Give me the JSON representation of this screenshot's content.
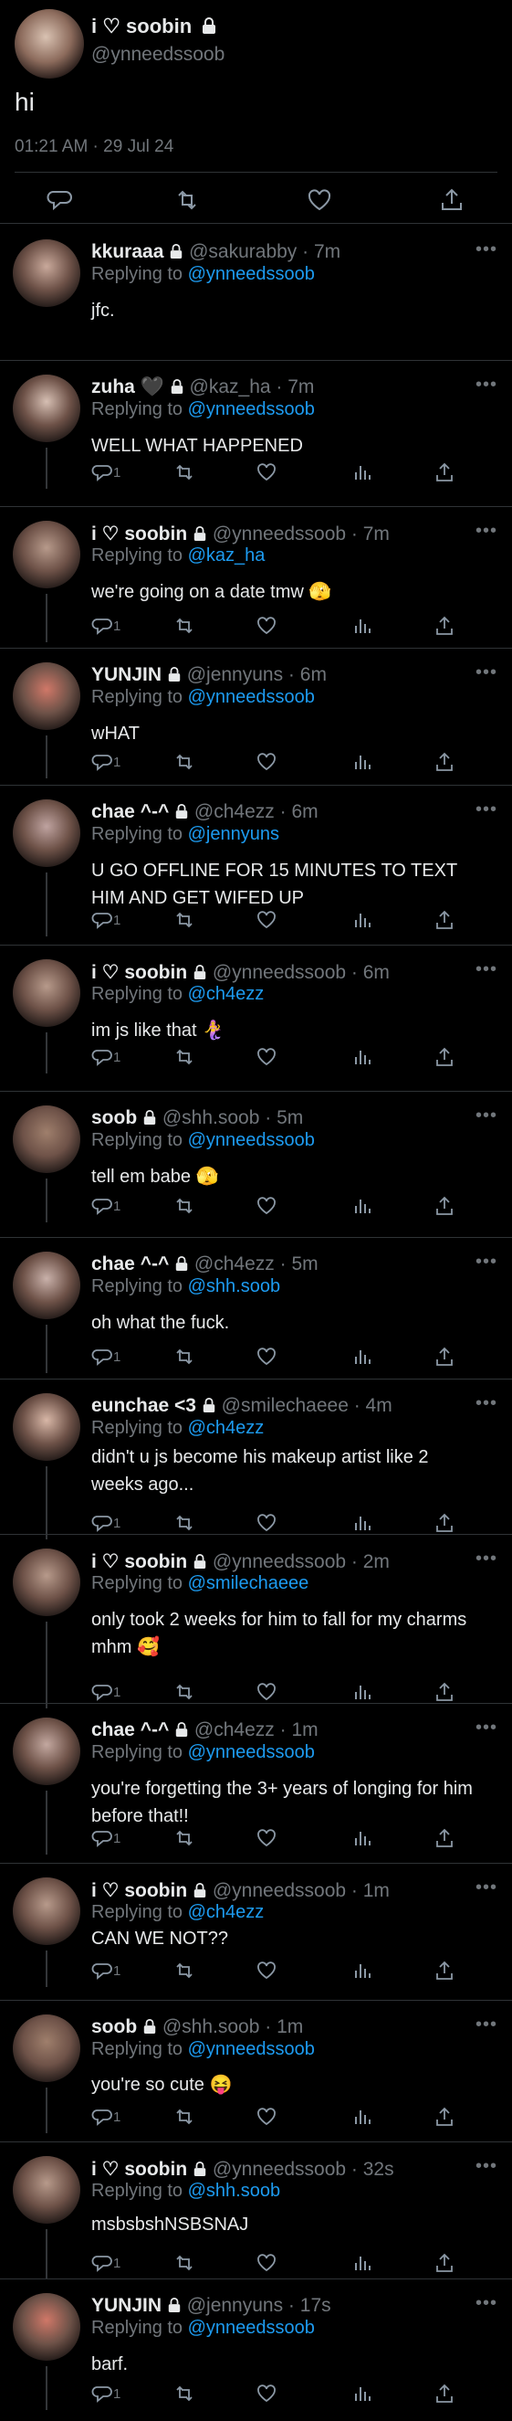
{
  "main_tweet": {
    "name": "i ♡ soobin",
    "handle": "@ynneedssoob",
    "text": "hi",
    "timestamp": "01:21 AM · 29 Jul 24",
    "icons": [
      "reply-icon",
      "retweet-icon",
      "like-icon",
      "share-icon"
    ]
  },
  "replies": [
    {
      "name": "kkuraaa",
      "handle": "@sakurabby · 7m",
      "replying_to": "@ynneedssoob",
      "text": "jfc.",
      "count": ""
    },
    {
      "name": "zuha 🖤",
      "handle": "@kaz_ha · 7m",
      "replying_to": "@ynneedssoob",
      "text": "WELL WHAT HAPPENED",
      "count": "1"
    },
    {
      "name": "i ♡ soobin",
      "handle": "@ynneedssoob · 7m",
      "replying_to": "@kaz_ha",
      "text": "we're going on a date tmw 🫣",
      "count": "1"
    },
    {
      "name": "YUNJIN",
      "handle": "@jennyuns · 6m",
      "replying_to": "@ynneedssoob",
      "text": "wHAT",
      "count": "1"
    },
    {
      "name": "chae ^-^",
      "handle": "@ch4ezz · 6m",
      "replying_to": "@jennyuns",
      "text": "U GO OFFLINE FOR 15 MINUTES TO TEXT HIM AND GET WIFED UP",
      "count": "1"
    },
    {
      "name": "i ♡ soobin",
      "handle": "@ynneedssoob · 6m",
      "replying_to": "@ch4ezz",
      "text": "im js like that 🧜‍♀️",
      "count": "1"
    },
    {
      "name": "soob",
      "handle": "@shh.soob · 5m",
      "replying_to": "@ynneedssoob",
      "text": "tell em babe 🫣",
      "count": "1"
    },
    {
      "name": "chae ^-^",
      "handle": "@ch4ezz · 5m",
      "replying_to": "@shh.soob",
      "text": "oh what the fuck.",
      "count": "1"
    },
    {
      "name": "eunchae <3",
      "handle": "@smilechaeee · 4m",
      "replying_to": "@ch4ezz",
      "text": "didn't u js become his makeup artist like 2 weeks ago...",
      "count": "1"
    },
    {
      "name": "i ♡ soobin",
      "handle": "@ynneedssoob · 2m",
      "replying_to": "@smilechaeee",
      "text": "only took 2 weeks for him to fall for my charms mhm 🥰",
      "count": "1"
    },
    {
      "name": "chae ^-^",
      "handle": "@ch4ezz · 1m",
      "replying_to": "@ynneedssoob",
      "text": "you're forgetting the 3+ years of longing for him before that!!",
      "count": "1"
    },
    {
      "name": "i ♡ soobin",
      "handle": "@ynneedssoob · 1m",
      "replying_to": "@ch4ezz",
      "text": "CAN WE NOT??",
      "count": "1"
    },
    {
      "name": "soob",
      "handle": "@shh.soob · 1m",
      "replying_to": "@ynneedssoob",
      "text": "you're so cute 😝",
      "count": "1"
    },
    {
      "name": "i ♡ soobin",
      "handle": "@ynneedssoob · 32s",
      "replying_to": "@shh.soob",
      "text": "msbsbshNSBSNAJ",
      "count": "1"
    },
    {
      "name": "YUNJIN",
      "handle": "@jennyuns · 17s",
      "replying_to": "@ynneedssoob",
      "text": "barf.",
      "count": "1"
    }
  ],
  "labels": {
    "replying_prefix": "Replying to ",
    "more": "•••"
  },
  "colors": {
    "background": "#000000",
    "text": "#e7e9ea",
    "muted": "#71767b",
    "link": "#1d9bf0",
    "divider": "#2f3336"
  }
}
